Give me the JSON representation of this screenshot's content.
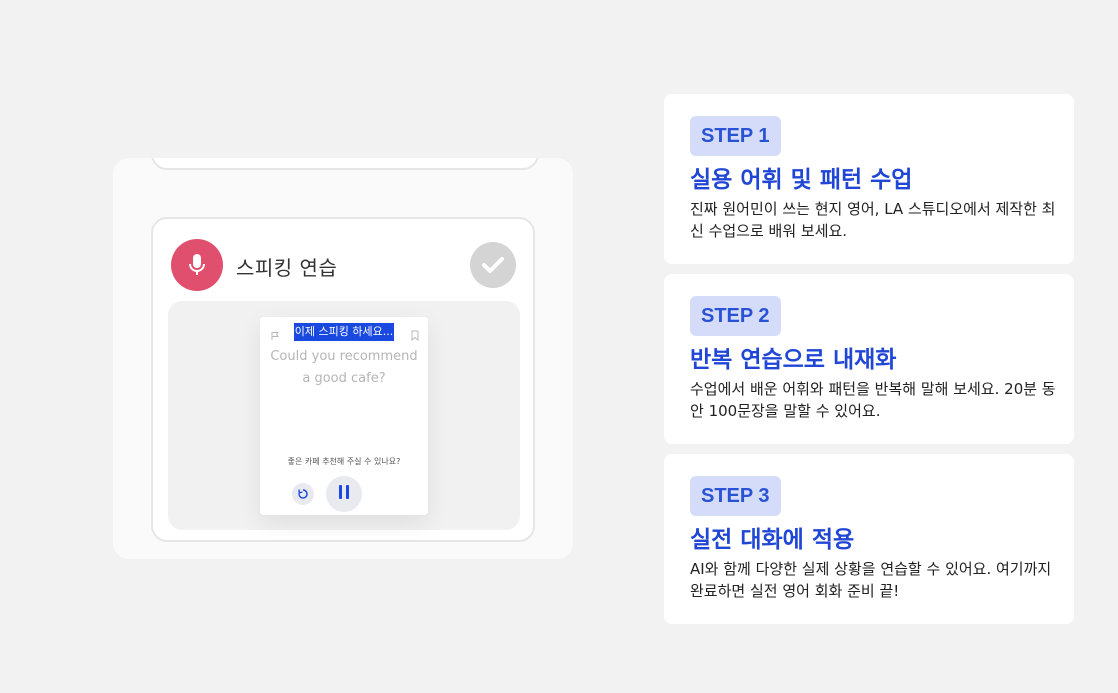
{
  "left": {
    "speaking_title": "스피킹 연습",
    "prompt_badge": "이제 스피킹 하세요...",
    "sentence": "Could you recommend a good cafe?",
    "translation": "좋은 카페 추천해 주실 수 있나요?",
    "mic_color": "#e0506e",
    "icons": [
      "mic-icon",
      "check-icon",
      "flag-icon",
      "bookmark-icon",
      "replay-icon",
      "pause-icon"
    ]
  },
  "steps": [
    {
      "badge": "STEP 1",
      "title": "실용 어휘 및 패턴 수업",
      "desc": "진짜 원어민이 쓰는 현지 영어, LA 스튜디오에서 제작한 최신 수업으로 배워 보세요."
    },
    {
      "badge": "STEP 2",
      "title": "반복 연습으로 내재화",
      "desc": "수업에서 배운 어휘와 패턴을 반복해 말해 보세요. 20분 동안 100문장을 말할 수 있어요."
    },
    {
      "badge": "STEP 3",
      "title": "실전 대화에 적용",
      "desc": "AI와 함께 다양한 실제 상황을 연습할 수 있어요. 여기까지 완료하면 실전 영어 회화 준비 끝!"
    }
  ],
  "colors": {
    "accent": "#2046d6",
    "badge_bg": "#d4dcfa",
    "prompt_bg": "#1a49e0"
  }
}
